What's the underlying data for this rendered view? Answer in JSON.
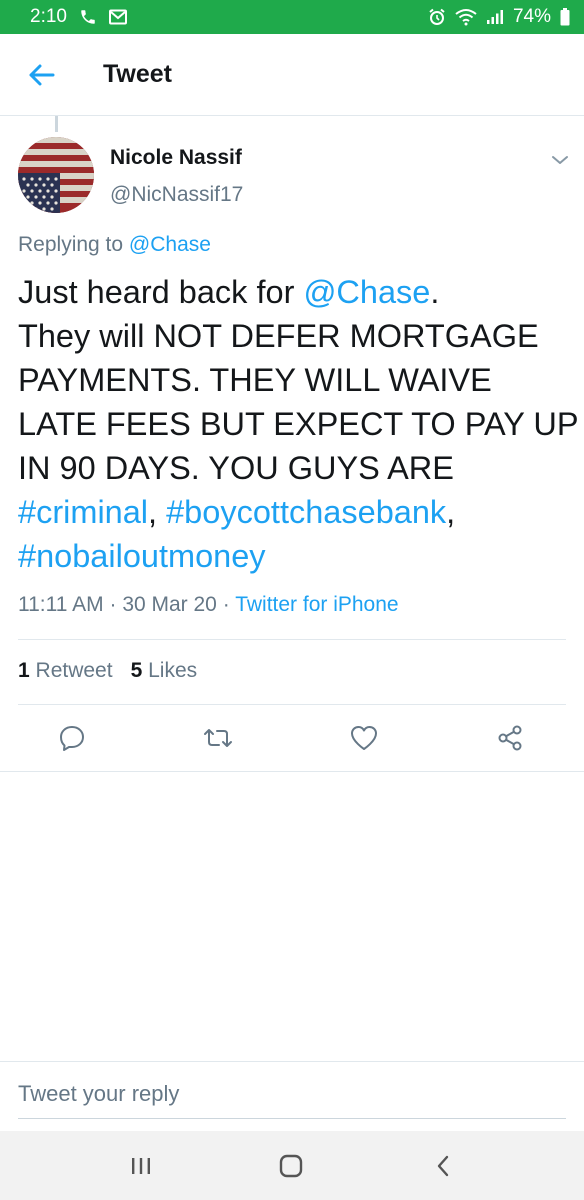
{
  "status_bar": {
    "time": "2:10",
    "battery": "74%",
    "background_color": "#1faa4b"
  },
  "header": {
    "title": "Tweet",
    "back_icon": "arrow-left-icon"
  },
  "tweet": {
    "author": {
      "name": "Nicole Nassif",
      "handle": "@NicNassif17",
      "avatar": "us-flag-upside-down"
    },
    "replying_to": {
      "prefix": "Replying to",
      "mention": "@Chase"
    },
    "text": {
      "part1": "Just heard back for ",
      "mention": "@Chase",
      "part2": ".\nThey will NOT DEFER MORTGAGE PAYMENTS. THEY WILL WAIVE LATE FEES BUT EXPECT TO PAY UP IN 90 DAYS. YOU GUYS ARE\n",
      "hashtag1": "#criminal",
      "sep1": ", ",
      "hashtag2": "#boycottchasebank",
      "sep2": ",\n",
      "hashtag3": "#nobailoutmoney"
    },
    "meta": {
      "time": "11:11 AM",
      "date": "30 Mar 20",
      "separator": "·",
      "source": "Twitter for iPhone"
    },
    "stats": {
      "retweets_count": "1",
      "retweets_label": "Retweet",
      "likes_count": "5",
      "likes_label": "Likes"
    },
    "link_color": "#1da1f2"
  },
  "actions": [
    "reply-icon",
    "retweet-icon",
    "like-icon",
    "share-icon"
  ],
  "reply_box": {
    "placeholder": "Tweet your reply"
  },
  "nav_bar": [
    "recents-icon",
    "home-icon",
    "back-icon"
  ]
}
